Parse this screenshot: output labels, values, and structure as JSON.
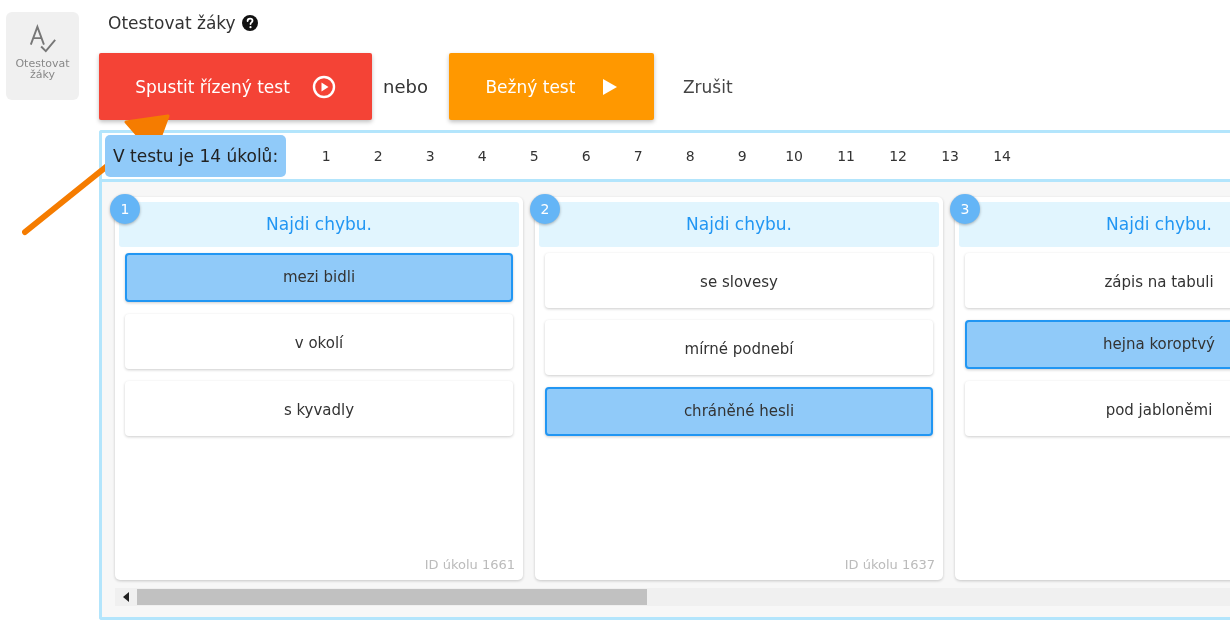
{
  "sidebar": {
    "items": [
      {
        "label": "Otestovat žáky",
        "selected": true
      }
    ]
  },
  "header": {
    "title": "Otestovat žáky"
  },
  "actions": {
    "primary": "Spustit řízený test",
    "separator": "nebo",
    "secondary": "Bežný test",
    "cancel": "Zrušit"
  },
  "task_nav": {
    "label": "V testu je 14 úkolů:",
    "numbers": [
      "1",
      "2",
      "3",
      "4",
      "5",
      "6",
      "7",
      "8",
      "9",
      "10",
      "11",
      "12",
      "13",
      "14"
    ]
  },
  "tasks": [
    {
      "number": "1",
      "prompt": "Najdi chybu.",
      "id_label": "ID úkolu 1661",
      "options": [
        {
          "text": "mezi bidli",
          "selected": true
        },
        {
          "text": "v okolí",
          "selected": false
        },
        {
          "text": "s kyvadly",
          "selected": false
        }
      ]
    },
    {
      "number": "2",
      "prompt": "Najdi chybu.",
      "id_label": "ID úkolu 1637",
      "options": [
        {
          "text": "se slovesy",
          "selected": false
        },
        {
          "text": "mírné podnebí",
          "selected": false
        },
        {
          "text": "chráněné hesli",
          "selected": true
        }
      ]
    },
    {
      "number": "3",
      "prompt": "Najdi chybu.",
      "options": [
        {
          "text": "zápis na tabuli",
          "selected": false
        },
        {
          "text": "hejna koroptvý",
          "selected": true
        },
        {
          "text": "pod jabloněmi",
          "selected": false
        }
      ]
    }
  ]
}
